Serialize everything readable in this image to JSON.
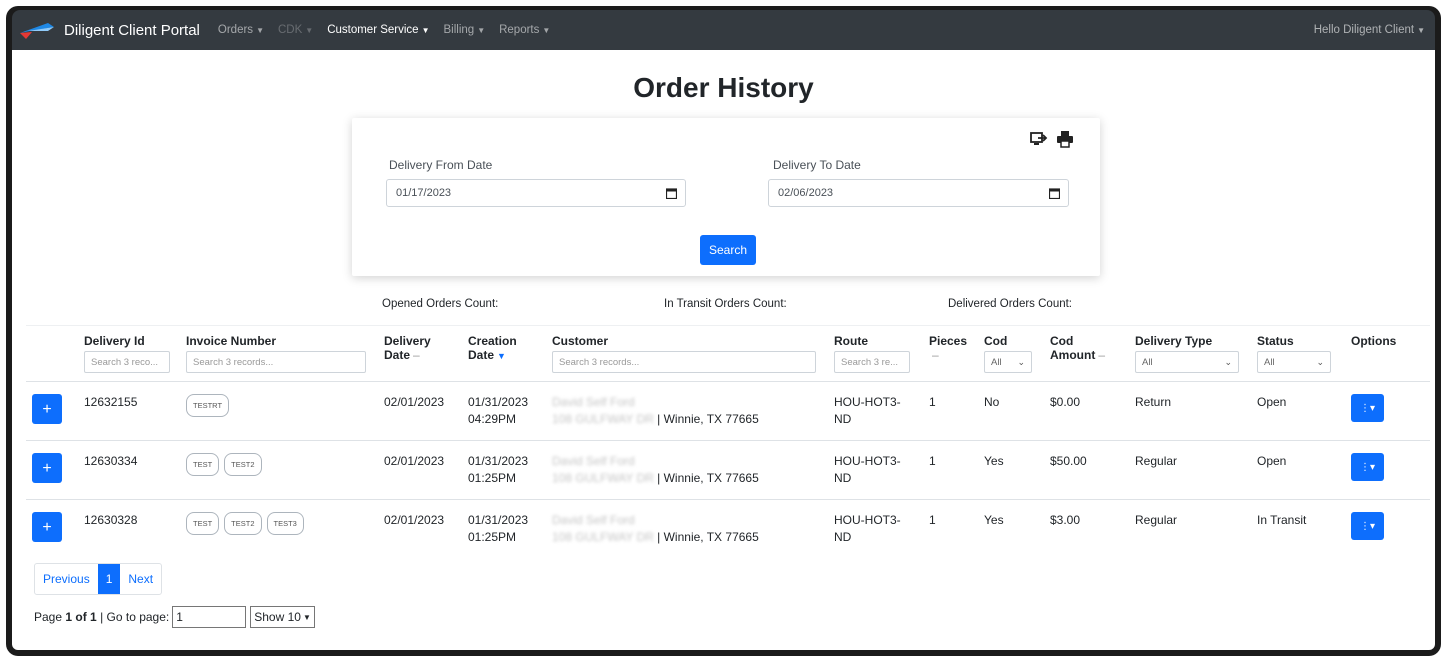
{
  "nav": {
    "brand": "Diligent Client Portal",
    "items": [
      {
        "label": "Orders",
        "state": "normal"
      },
      {
        "label": "CDK",
        "state": "disabled"
      },
      {
        "label": "Customer Service",
        "state": "active"
      },
      {
        "label": "Billing",
        "state": "normal"
      },
      {
        "label": "Reports",
        "state": "normal"
      }
    ],
    "user": "Hello Diligent Client"
  },
  "page": {
    "title": "Order History"
  },
  "filters": {
    "from_label": "Delivery From Date",
    "from_value": "01/17/2023",
    "to_label": "Delivery To Date",
    "to_value": "02/06/2023",
    "search_label": "Search"
  },
  "counts": {
    "opened": "Opened Orders Count:",
    "in_transit": "In Transit Orders Count:",
    "delivered": "Delivered Orders Count:"
  },
  "table": {
    "headers": {
      "delivery_id": "Delivery Id",
      "invoice_number": "Invoice Number",
      "delivery_date_1": "Delivery",
      "delivery_date_2": "Date",
      "creation_date_1": "Creation",
      "creation_date_2": "Date",
      "customer": "Customer",
      "route": "Route",
      "pieces": "Pieces",
      "cod": "Cod",
      "cod_amount_1": "Cod",
      "cod_amount_2": "Amount",
      "delivery_type": "Delivery Type",
      "status": "Status",
      "options": "Options"
    },
    "filters": {
      "delivery_id": "Search 3 reco...",
      "invoice_number": "Search 3 records...",
      "customer": "Search 3 records...",
      "route": "Search 3 re...",
      "cod": "All",
      "delivery_type": "All",
      "status": "All"
    },
    "rows": [
      {
        "delivery_id": "12632155",
        "invoices": [
          "TESTRT"
        ],
        "delivery_date": "02/01/2023",
        "creation_date": "01/31/2023",
        "creation_time": "04:29PM",
        "customer_name": "David Self Ford",
        "customer_street": "108 GULFWAY DR",
        "customer_city": " | Winnie, TX 77665",
        "route": "HOU-HOT3-",
        "route2": "ND",
        "pieces": "1",
        "cod": "No",
        "cod_amount": "$0.00",
        "delivery_type": "Return",
        "status": "Open"
      },
      {
        "delivery_id": "12630334",
        "invoices": [
          "TEST",
          "TEST2"
        ],
        "delivery_date": "02/01/2023",
        "creation_date": "01/31/2023",
        "creation_time": "01:25PM",
        "customer_name": "David Self Ford",
        "customer_street": "108 GULFWAY DR",
        "customer_city": " | Winnie, TX 77665",
        "route": "HOU-HOT3-",
        "route2": "ND",
        "pieces": "1",
        "cod": "Yes",
        "cod_amount": "$50.00",
        "delivery_type": "Regular",
        "status": "Open"
      },
      {
        "delivery_id": "12630328",
        "invoices": [
          "TEST",
          "TEST2",
          "TEST3"
        ],
        "delivery_date": "02/01/2023",
        "creation_date": "01/31/2023",
        "creation_time": "01:25PM",
        "customer_name": "David Self Ford",
        "customer_street": "108 GULFWAY DR",
        "customer_city": " | Winnie, TX 77665",
        "route": "HOU-HOT3-",
        "route2": "ND",
        "pieces": "1",
        "cod": "Yes",
        "cod_amount": "$3.00",
        "delivery_type": "Regular",
        "status": "In Transit"
      }
    ]
  },
  "pagination": {
    "previous": "Previous",
    "current": "1",
    "next": "Next",
    "page_prefix": "Page",
    "page_of": "1 of 1",
    "goto_label": "| Go to page:",
    "goto_value": "1",
    "show": "Show 10"
  },
  "colors": {
    "accent": "#0d6efd",
    "navbar": "#343a40"
  }
}
